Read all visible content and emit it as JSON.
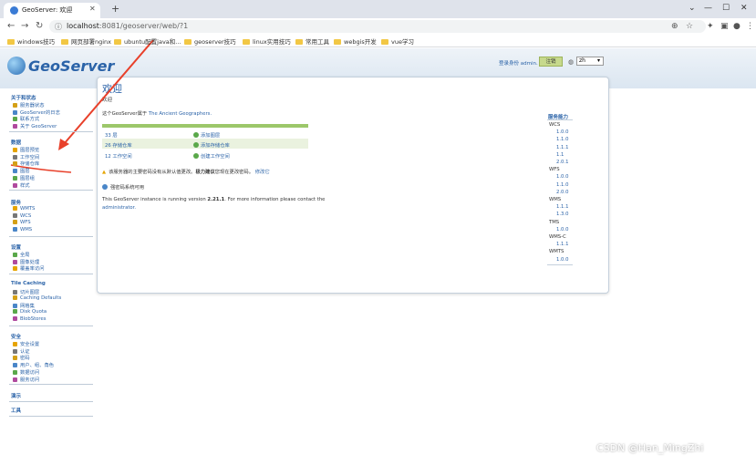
{
  "browser": {
    "tab_title": "GeoServer: 欢迎",
    "url_host": "localhost",
    "url_path": ":8081/geoserver/web/?1",
    "bookmarks": [
      "windows技巧",
      "网页部署nginx",
      "ubuntu配置java和...",
      "geoserver技巧",
      "linux实用技巧",
      "常用工具",
      "webgis开发",
      "vue学习"
    ]
  },
  "header": {
    "logo": "GeoServer",
    "login_text": "登录身份 admin.",
    "login_button": "注销",
    "language": "zh"
  },
  "sidebar": {
    "sections": [
      {
        "title": "关于和状态",
        "items": [
          "服务器状态",
          "GeoServer的日志",
          "联系方式",
          "关于 GeoServer"
        ]
      },
      {
        "title": "数据",
        "items": [
          "图层预览",
          "工作空间",
          "存储仓库",
          "图层",
          "图层组",
          "样式"
        ]
      },
      {
        "title": "服务",
        "items": [
          "WMTS",
          "WCS",
          "WFS",
          "WMS"
        ]
      },
      {
        "title": "设置",
        "items": [
          "全局",
          "图像处理",
          "覆盖率访问"
        ]
      },
      {
        "title": "Tile Caching",
        "items": [
          "切片图层",
          "Caching Defaults",
          "网格集",
          "Disk Quota",
          "BlobStores"
        ]
      },
      {
        "title": "安全",
        "items": [
          "安全设置",
          "认证",
          "密码",
          "用户、组、角色",
          "数据访问",
          "服务访问"
        ]
      },
      {
        "title": "演示",
        "items": []
      },
      {
        "title": "工具",
        "items": []
      }
    ]
  },
  "main": {
    "title": "欢迎",
    "subtitle": "欢迎",
    "description": "这个GeoServer属于",
    "description_link": "The Ancient Geographers.",
    "stats": [
      {
        "count": "33 层",
        "action": "添加图层"
      },
      {
        "count": "26 存储仓库",
        "action": "添加存储仓库"
      },
      {
        "count": "12 工作空间",
        "action": "创建工作空间"
      }
    ],
    "warning_prefix": "该服务器的主要密码没有从默认值更改。",
    "warning_bold": "极力建议",
    "warning_suffix": "您现在更改密码。",
    "warning_link": "修改它",
    "info": "强密码系统可用",
    "running_prefix": "This GeoServer instance is running version ",
    "running_version": "2.21.1",
    "running_suffix": ". For more information please contact the",
    "admin_link": "administrator."
  },
  "capabilities": {
    "title": "服务能力",
    "services": [
      {
        "name": "WCS",
        "versions": [
          "1.0.0",
          "1.1.0",
          "1.1.1",
          "1.1",
          "2.0.1"
        ]
      },
      {
        "name": "WFS",
        "versions": [
          "1.0.0",
          "1.1.0",
          "2.0.0"
        ]
      },
      {
        "name": "WMS",
        "versions": [
          "1.1.1",
          "1.3.0"
        ]
      },
      {
        "name": "TMS",
        "versions": [
          "1.0.0"
        ]
      },
      {
        "name": "WMS-C",
        "versions": [
          "1.1.1"
        ]
      },
      {
        "name": "WMTS",
        "versions": [
          "1.0.0"
        ]
      }
    ]
  },
  "watermark": "CSDN @Han_MingZhi",
  "colors": {
    "accent": "#2b63a8",
    "arrow": "#e8402a",
    "statbar": "#9cc76a"
  }
}
